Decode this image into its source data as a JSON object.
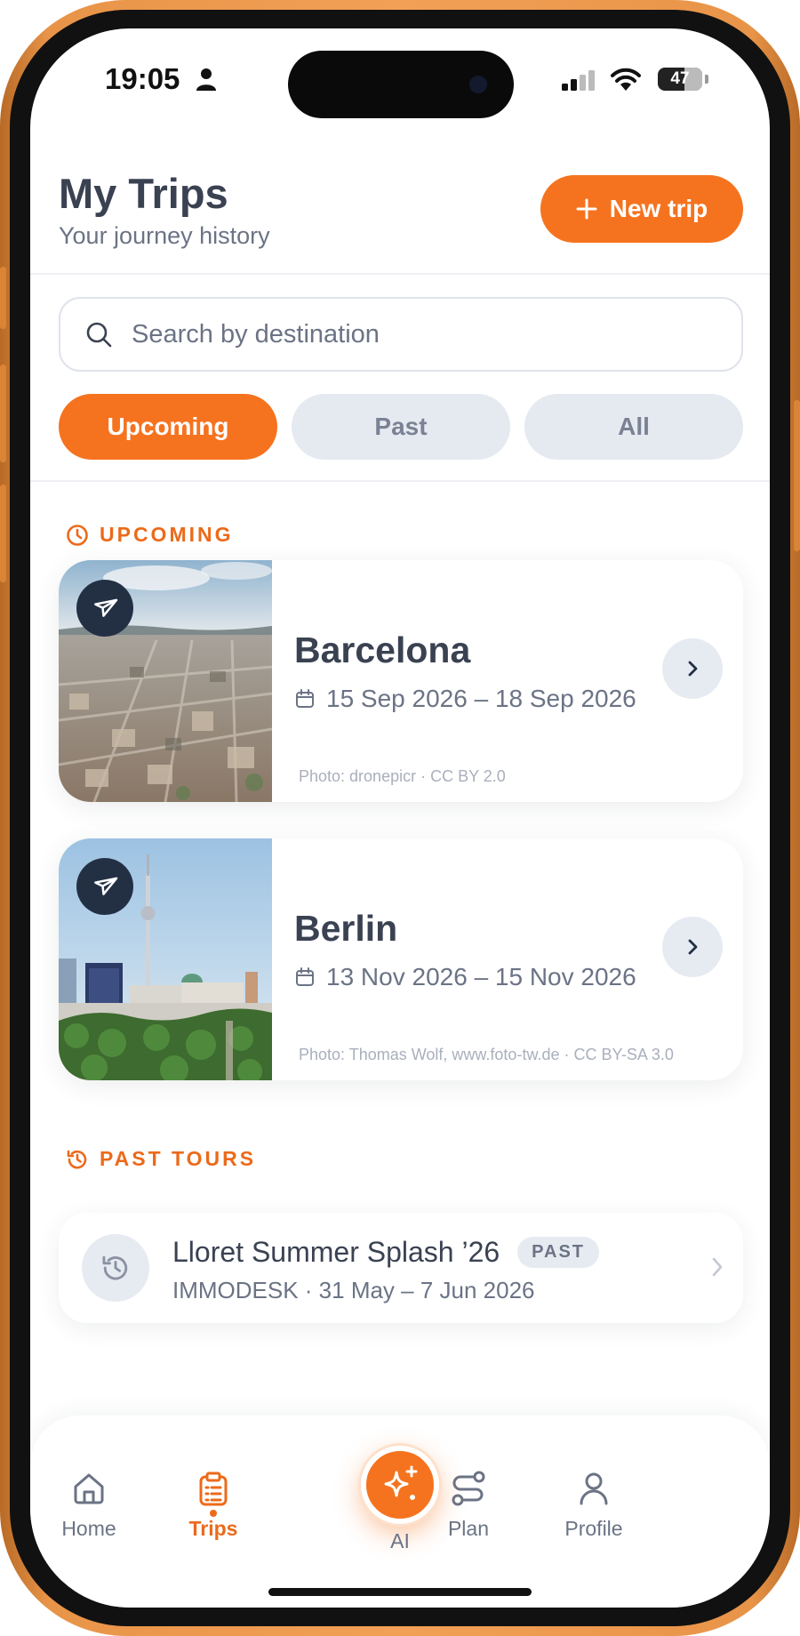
{
  "status_bar": {
    "time": "19:05",
    "battery": "47"
  },
  "header": {
    "title": "My Trips",
    "subtitle": "Your journey history",
    "new_trip_label": "New trip"
  },
  "search": {
    "placeholder": "Search by destination"
  },
  "filters": [
    {
      "label": "Upcoming",
      "active": true
    },
    {
      "label": "Past",
      "active": false
    },
    {
      "label": "All",
      "active": false
    }
  ],
  "sections": {
    "upcoming": "UPCOMING",
    "past": "PAST TOURS"
  },
  "trips": [
    {
      "city": "Barcelona",
      "dates": "15 Sep 2026 – 18 Sep 2026",
      "credit": "Photo: dronepicr · CC BY 2.0"
    },
    {
      "city": "Berlin",
      "dates": "13 Nov 2026 – 15 Nov 2026",
      "credit": "Photo: Thomas Wolf, www.foto-tw.de · CC BY-SA 3.0"
    }
  ],
  "past_tours": [
    {
      "title": "Lloret Summer Splash ’26",
      "badge": "PAST",
      "meta": "IMMODESK · 31 May – 7 Jun 2026"
    }
  ],
  "nav": {
    "home": "Home",
    "trips": "Trips",
    "ai": "AI",
    "plan": "Plan",
    "profile": "Profile"
  },
  "colors": {
    "accent": "#f5731f",
    "text": "#3a4252",
    "muted": "#6b7385",
    "chip": "#e5eaf1"
  }
}
